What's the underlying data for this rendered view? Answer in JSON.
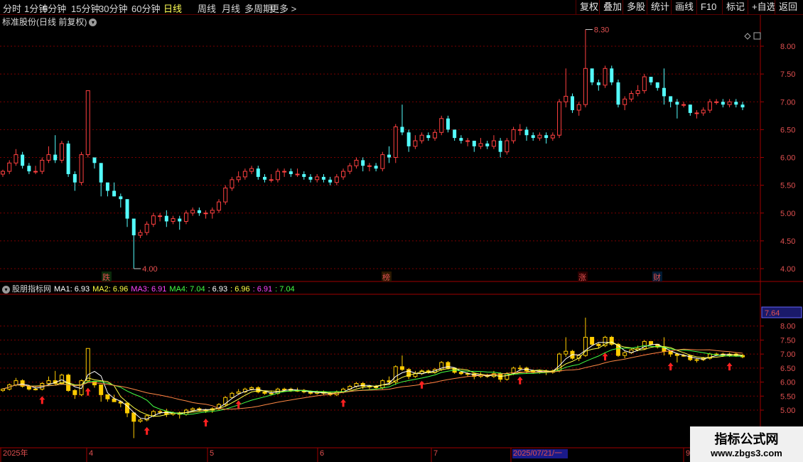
{
  "toolbar": {
    "left": [
      {
        "label": "分时",
        "active": false
      },
      {
        "label": "1分钟",
        "active": false
      },
      {
        "label": "5分钟",
        "active": false
      },
      {
        "label": "15分钟",
        "active": false
      },
      {
        "label": "30分钟",
        "active": false
      },
      {
        "label": "60分钟",
        "active": false
      },
      {
        "label": "日线",
        "active": true
      },
      {
        "label": "周线",
        "active": false
      },
      {
        "label": "月线",
        "active": false
      },
      {
        "label": "多周期",
        "active": false
      },
      {
        "label": "更多 >",
        "active": false
      }
    ],
    "right": [
      "复权",
      "叠加",
      "多股",
      "统计",
      "画线",
      "F10",
      "标记",
      "+自选",
      "返回"
    ]
  },
  "main": {
    "title": "标准股份(日线 前复权)",
    "high_label": "8.30",
    "low_label": "4.00",
    "badges": [
      {
        "text": "跌",
        "color": "#33cc33",
        "bg": "#0a2a0a"
      },
      {
        "text": "榜",
        "color": "#ff9933",
        "bg": "#2a1800"
      },
      {
        "text": "涨",
        "color": "#ff4444",
        "bg": "#2a0000"
      },
      {
        "text": "财",
        "color": "#66bbff",
        "bg": "#001a33"
      }
    ]
  },
  "sub": {
    "name": "股朋指标网",
    "ma1": "MA1: 6.93",
    "ma2": "MA2: 6.96",
    "ma3": "MA3: 6.91",
    "ma4": "MA4: 7.04",
    "v1": ": 6.93",
    "v2": ": 6.96",
    "v3": ": 6.91",
    "v4": ": 7.04",
    "price_tag": "7.64"
  },
  "xaxis": {
    "labels": [
      "2025年",
      "4",
      "5",
      "6",
      "7",
      "2025/07/21/一",
      "9"
    ]
  },
  "watermark": {
    "line1": "指标公式网",
    "line2": "www.zbgs3.com"
  },
  "colors": {
    "up": "#ff4040",
    "down": "#54ffff",
    "bar": "#ffcc00",
    "ma1": "#ffffff",
    "ma2": "#ffff44",
    "ma3": "#ff44ff",
    "ma4": "#44ff44",
    "arrow": "#ff2020"
  },
  "chart_data": {
    "type": "candlestick",
    "main_ylim": [
      3.85,
      8.45
    ],
    "main_yticks": [
      "8.00",
      "7.50",
      "7.00",
      "6.50",
      "6.00",
      "5.50",
      "5.00",
      "4.50",
      "4.00"
    ],
    "sub_ylim": [
      4.7,
      8.55
    ],
    "sub_yticks": [
      "8.00",
      "7.50",
      "7.00",
      "6.50",
      "6.00",
      "5.50",
      "5.00"
    ],
    "candles": [
      [
        5.7,
        5.75,
        5.78,
        5.65
      ],
      [
        5.75,
        5.9,
        5.95,
        5.7
      ],
      [
        5.9,
        6.05,
        6.15,
        5.85
      ],
      [
        6.05,
        5.85,
        6.1,
        5.8
      ],
      [
        5.85,
        5.75,
        5.9,
        5.7
      ],
      [
        5.75,
        5.75,
        5.85,
        5.7
      ],
      [
        5.75,
        5.95,
        6.0,
        5.7
      ],
      [
        5.95,
        6.05,
        6.2,
        5.9
      ],
      [
        6.05,
        5.95,
        6.4,
        5.9
      ],
      [
        5.95,
        6.25,
        6.3,
        5.9
      ],
      [
        6.25,
        5.7,
        6.3,
        5.65
      ],
      [
        5.7,
        5.55,
        5.75,
        5.4
      ],
      [
        5.55,
        6.05,
        6.1,
        5.5
      ],
      [
        6.05,
        7.2,
        7.2,
        6.0
      ],
      [
        6.0,
        5.9,
        6.0,
        5.8
      ],
      [
        5.9,
        5.55,
        5.8,
        5.3
      ],
      [
        5.55,
        5.4,
        5.5,
        5.3
      ],
      [
        5.4,
        5.3,
        5.55,
        5.3
      ],
      [
        5.3,
        5.25,
        5.35,
        5.1
      ],
      [
        5.25,
        4.9,
        5.0,
        4.75
      ],
      [
        4.9,
        4.6,
        4.8,
        4.0
      ],
      [
        4.6,
        4.65,
        4.7,
        4.55
      ],
      [
        4.65,
        4.8,
        4.85,
        4.6
      ],
      [
        4.8,
        4.95,
        5.0,
        4.75
      ],
      [
        4.95,
        4.95,
        5.0,
        4.85
      ],
      [
        4.95,
        4.85,
        5.05,
        4.75
      ],
      [
        4.85,
        4.9,
        4.95,
        4.8
      ],
      [
        4.9,
        4.85,
        4.95,
        4.7
      ],
      [
        4.85,
        5.0,
        5.05,
        4.8
      ],
      [
        5.0,
        5.05,
        5.1,
        4.95
      ],
      [
        5.05,
        5.0,
        5.1,
        4.95
      ],
      [
        5.0,
        5.0,
        5.05,
        4.9
      ],
      [
        5.0,
        5.05,
        5.1,
        4.9
      ],
      [
        5.05,
        5.2,
        5.25,
        5.0
      ],
      [
        5.2,
        5.45,
        5.5,
        5.15
      ],
      [
        5.45,
        5.6,
        5.65,
        5.4
      ],
      [
        5.6,
        5.65,
        5.75,
        5.55
      ],
      [
        5.65,
        5.75,
        5.8,
        5.6
      ],
      [
        5.75,
        5.8,
        5.85,
        5.7
      ],
      [
        5.8,
        5.65,
        5.85,
        5.6
      ],
      [
        5.65,
        5.6,
        5.7,
        5.55
      ],
      [
        5.6,
        5.6,
        5.7,
        5.55
      ],
      [
        5.6,
        5.75,
        5.8,
        5.55
      ],
      [
        5.75,
        5.75,
        5.8,
        5.65
      ],
      [
        5.75,
        5.7,
        5.8,
        5.65
      ],
      [
        5.7,
        5.7,
        5.8,
        5.65
      ],
      [
        5.7,
        5.65,
        5.75,
        5.6
      ],
      [
        5.65,
        5.6,
        5.7,
        5.55
      ],
      [
        5.6,
        5.65,
        5.7,
        5.55
      ],
      [
        5.65,
        5.6,
        5.7,
        5.55
      ],
      [
        5.6,
        5.55,
        5.65,
        5.5
      ],
      [
        5.55,
        5.65,
        5.7,
        5.5
      ],
      [
        5.65,
        5.75,
        5.8,
        5.6
      ],
      [
        5.75,
        5.85,
        5.9,
        5.7
      ],
      [
        5.85,
        5.95,
        6.0,
        5.8
      ],
      [
        5.95,
        5.85,
        6.0,
        5.75
      ],
      [
        5.85,
        5.85,
        5.9,
        5.75
      ],
      [
        5.85,
        5.8,
        5.9,
        5.75
      ],
      [
        5.8,
        6.05,
        6.1,
        5.75
      ],
      [
        6.05,
        6.0,
        6.2,
        5.9
      ],
      [
        6.0,
        6.55,
        6.6,
        5.9
      ],
      [
        6.55,
        6.45,
        6.95,
        6.4
      ],
      [
        6.45,
        6.2,
        6.5,
        6.1
      ],
      [
        6.2,
        6.3,
        6.4,
        6.15
      ],
      [
        6.3,
        6.4,
        6.45,
        6.25
      ],
      [
        6.4,
        6.35,
        6.45,
        6.3
      ],
      [
        6.35,
        6.45,
        6.5,
        6.3
      ],
      [
        6.45,
        6.7,
        6.75,
        6.4
      ],
      [
        6.7,
        6.5,
        6.75,
        6.45
      ],
      [
        6.5,
        6.35,
        6.5,
        6.3
      ],
      [
        6.35,
        6.3,
        6.4,
        6.25
      ],
      [
        6.3,
        6.3,
        6.35,
        6.2
      ],
      [
        6.3,
        6.2,
        6.3,
        6.1
      ],
      [
        6.2,
        6.25,
        6.35,
        6.15
      ],
      [
        6.25,
        6.2,
        6.3,
        6.15
      ],
      [
        6.2,
        6.3,
        6.4,
        6.15
      ],
      [
        6.3,
        6.1,
        6.35,
        6.0
      ],
      [
        6.1,
        6.3,
        6.35,
        6.05
      ],
      [
        6.3,
        6.5,
        6.55,
        6.25
      ],
      [
        6.5,
        6.5,
        6.6,
        6.4
      ],
      [
        6.5,
        6.4,
        6.55,
        6.3
      ],
      [
        6.4,
        6.35,
        6.45,
        6.3
      ],
      [
        6.35,
        6.4,
        6.45,
        6.3
      ],
      [
        6.4,
        6.35,
        6.45,
        6.25
      ],
      [
        6.35,
        6.4,
        6.45,
        6.3
      ],
      [
        6.4,
        7.0,
        7.05,
        6.35
      ],
      [
        7.0,
        7.1,
        7.6,
        6.9
      ],
      [
        7.1,
        6.85,
        7.15,
        6.8
      ],
      [
        6.85,
        6.95,
        7.0,
        6.75
      ],
      [
        6.95,
        7.6,
        8.3,
        6.9
      ],
      [
        7.6,
        7.35,
        7.5,
        7.3
      ],
      [
        7.35,
        7.3,
        7.4,
        7.2
      ],
      [
        7.3,
        7.6,
        7.65,
        7.25
      ],
      [
        7.6,
        7.35,
        7.65,
        7.3
      ],
      [
        7.35,
        6.95,
        7.4,
        6.9
      ],
      [
        6.95,
        7.05,
        7.1,
        6.85
      ],
      [
        7.05,
        7.15,
        7.2,
        7.0
      ],
      [
        7.15,
        7.2,
        7.3,
        7.1
      ],
      [
        7.2,
        7.45,
        7.5,
        7.15
      ],
      [
        7.45,
        7.35,
        7.45,
        7.3
      ],
      [
        7.35,
        7.25,
        7.35,
        7.2
      ],
      [
        7.25,
        7.1,
        7.6,
        6.95
      ],
      [
        7.1,
        7.0,
        7.1,
        6.9
      ],
      [
        7.0,
        6.95,
        7.05,
        6.7
      ],
      [
        6.95,
        6.95,
        7.0,
        6.9
      ],
      [
        6.95,
        6.8,
        6.95,
        6.75
      ],
      [
        6.8,
        6.8,
        6.85,
        6.7
      ],
      [
        6.8,
        6.85,
        6.9,
        6.75
      ],
      [
        6.85,
        7.0,
        7.05,
        6.8
      ],
      [
        7.0,
        7.0,
        7.05,
        6.95
      ],
      [
        7.0,
        6.95,
        7.05,
        6.9
      ],
      [
        6.95,
        7.0,
        7.05,
        6.9
      ],
      [
        7.0,
        6.95,
        7.05,
        6.9
      ],
      [
        6.95,
        6.9,
        7.0,
        6.85
      ]
    ],
    "arrow_idx": [
      6,
      13,
      22,
      31,
      36,
      52,
      64,
      79,
      92,
      102,
      111,
      123,
      131,
      140,
      146,
      160
    ],
    "ma_lines": [
      "MA1",
      "MA2",
      "MA3",
      "MA4"
    ]
  }
}
